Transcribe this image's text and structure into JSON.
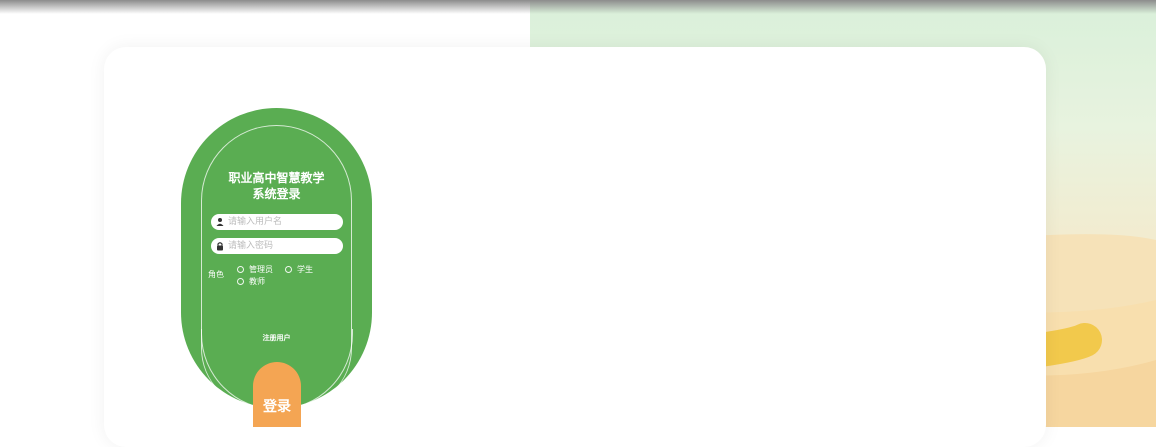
{
  "login": {
    "title_line1": "职业高中智慧教学",
    "title_line2": "系统登录",
    "username_placeholder": "请输入用户名",
    "password_placeholder": "请输入密码",
    "role_label": "角色",
    "roles": [
      "管理员",
      "学生",
      "教师"
    ],
    "forgot_text": "注册用户",
    "login_button": "登录"
  },
  "colors": {
    "capsule_green": "#5aad52",
    "button_orange": "#f4a553"
  },
  "icons": [
    "user-icon",
    "lock-icon"
  ]
}
